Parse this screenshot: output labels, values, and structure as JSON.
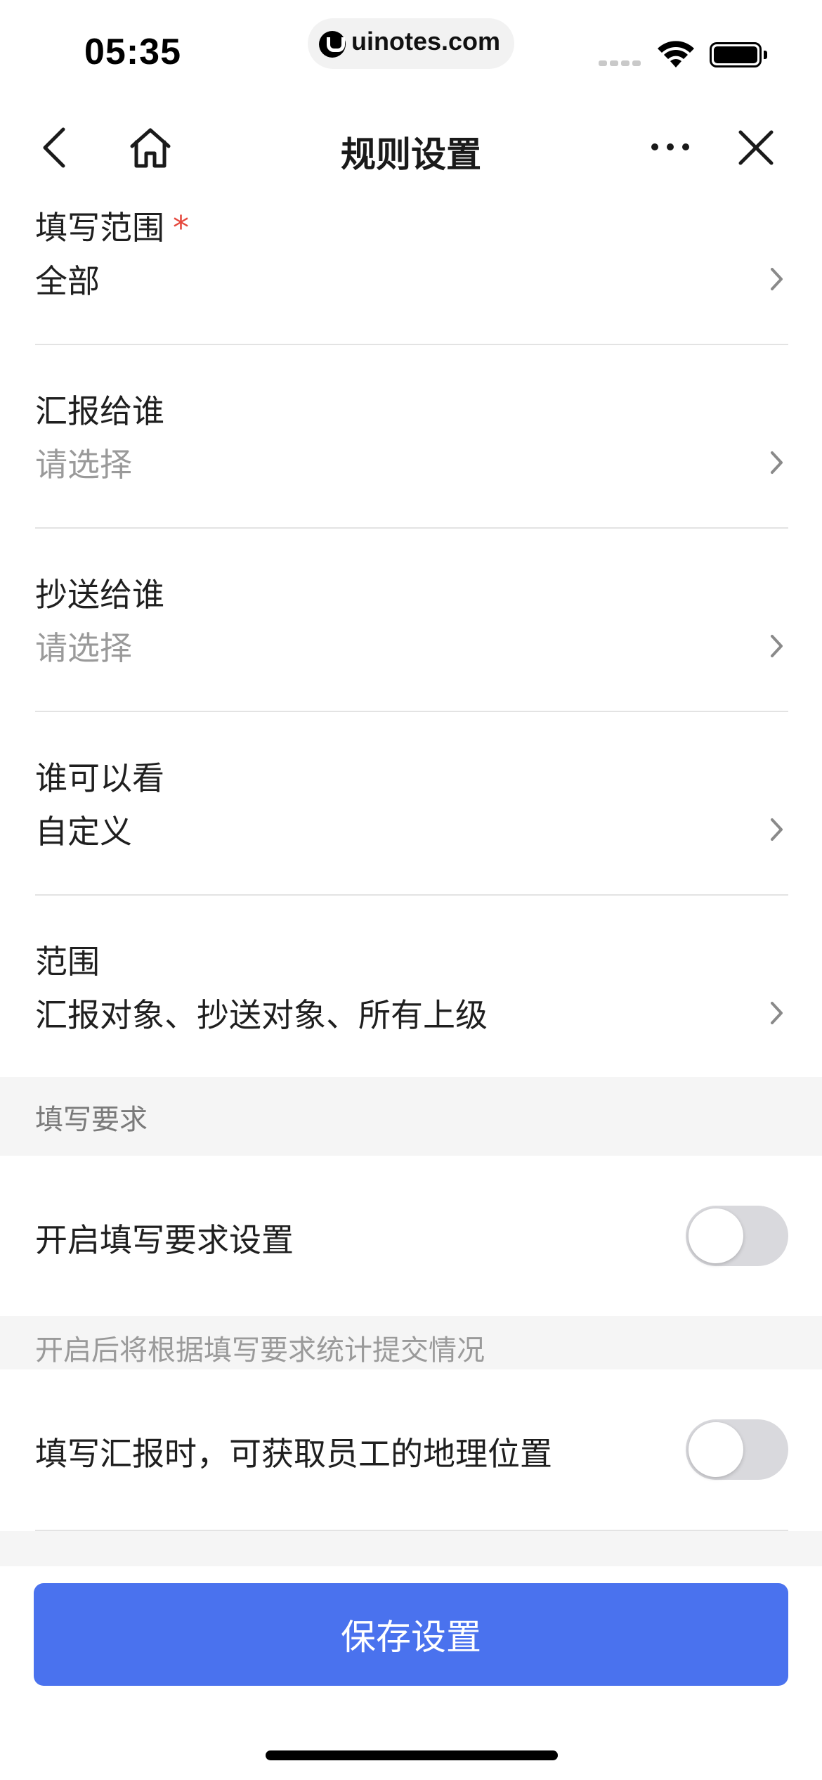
{
  "status_bar": {
    "time": "05:35",
    "url": "uinotes.com"
  },
  "nav": {
    "title": "规则设置"
  },
  "rows": {
    "fill_scope": {
      "label": "填写范围",
      "required_mark": "*",
      "value": "全部"
    },
    "report_to": {
      "label": "汇报给谁",
      "value": "请选择"
    },
    "cc_to": {
      "label": "抄送给谁",
      "value": "请选择"
    },
    "who_can_see": {
      "label": "谁可以看",
      "value": "自定义"
    },
    "scope": {
      "label": "范围",
      "value": "汇报对象、抄送对象、所有上级"
    }
  },
  "fill_requirements": {
    "section_title": "填写要求",
    "enable_label": "开启填写要求设置",
    "enable_on": false,
    "hint": "开启后将根据填写要求统计提交情况",
    "location_label": "填写汇报时，可获取员工的地理位置",
    "location_on": false
  },
  "footer": {
    "save_label": "保存设置"
  },
  "colors": {
    "primary": "#4a72ee",
    "required": "#e5483d",
    "placeholder": "#9a9a9a",
    "section_bg": "#f5f5f5",
    "toggle_off": "#d9d9dd"
  }
}
